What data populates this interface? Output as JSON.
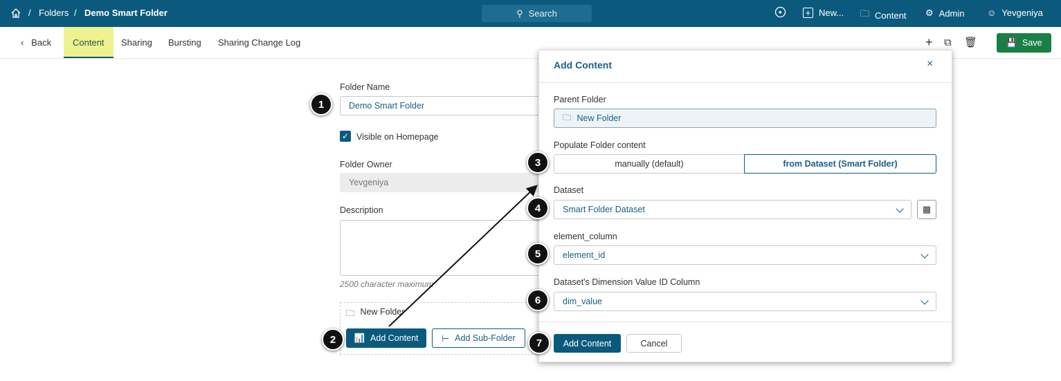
{
  "topbar": {
    "breadcrumb": [
      "Folders",
      "Demo Smart Folder"
    ],
    "search": "Search",
    "new": "New...",
    "content": "Content",
    "admin": "Admin",
    "user": "Yevgeniya"
  },
  "tabs": {
    "back": "Back",
    "items": [
      "Content",
      "Sharing",
      "Bursting",
      "Sharing Change Log"
    ],
    "save": "Save"
  },
  "form": {
    "folder_name_label": "Folder Name",
    "folder_name": "Demo Smart Folder",
    "visible_label": "Visible on Homepage",
    "owner_label": "Folder Owner",
    "owner": "Yevgeniya",
    "description_label": "Description",
    "description_hint": "2500 character maximum",
    "tree_item": "New Folder",
    "add_content": "Add Content",
    "add_subfolder": "Add Sub-Folder"
  },
  "modal": {
    "title": "Add Content",
    "parent_label": "Parent Folder",
    "parent": "New Folder",
    "populate_label": "Populate Folder content",
    "opt_manual": "manually (default)",
    "opt_dataset": "from Dataset (Smart Folder)",
    "dataset_label": "Dataset",
    "dataset": "Smart Folder Dataset",
    "element_label": "element_column",
    "element": "element_id",
    "dim_label": "Dataset's Dimension Value ID Column",
    "dim": "dim_value",
    "submit": "Add Content",
    "cancel": "Cancel"
  },
  "badges": [
    "1",
    "2",
    "3",
    "4",
    "5",
    "6",
    "7"
  ],
  "colors": {
    "primary": "#0b5a7e",
    "save": "#1a7f45",
    "active_tab": "#eef28f"
  }
}
